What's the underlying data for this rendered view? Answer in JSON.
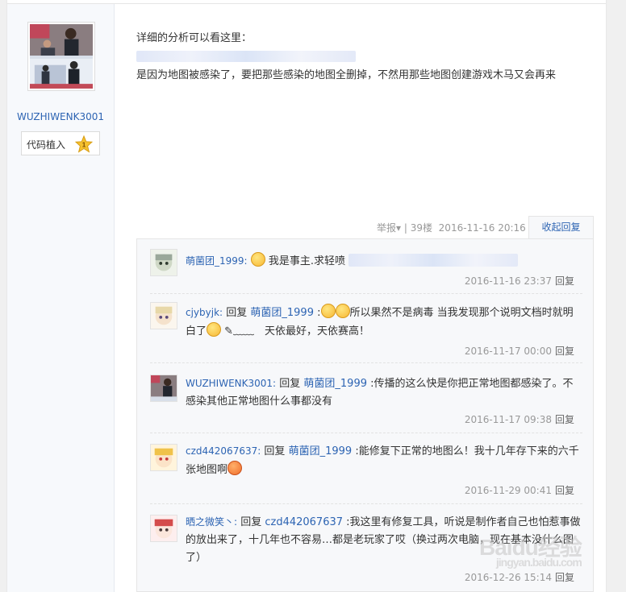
{
  "author": {
    "username": "WUZHIWENK3001",
    "badge_label": "代码植入",
    "badge_level": "1"
  },
  "post": {
    "line1": "详细的分析可以看这里：",
    "line3": "是因为地图被感染了，要把那些感染的地图全删掉，不然用那些地图创建游戏木马又会再来"
  },
  "meta": {
    "report": "举报",
    "arrow": "▾",
    "divider": "|",
    "floor": "39楼",
    "time": "2016-11-16 20:16",
    "collapse_label": "收起回复"
  },
  "replies": [
    {
      "name": "萌菌团_1999:",
      "text": "我是事主.求轻喷",
      "time": "2016-11-16 23:37",
      "reply_label": "回复"
    },
    {
      "name": "cjybyjk:",
      "prefix": "回复",
      "target": "萌菌团_1999",
      "sep": ":",
      "text1": "所以果然不是病毒 当我发现那个说明文档时就明白了",
      "text2": "✎﹏﹏　天依最好，天依赛高！",
      "time": "2016-11-17 00:00",
      "reply_label": "回复"
    },
    {
      "name": "WUZHIWENK3001:",
      "prefix": "回复",
      "target": "萌菌团_1999",
      "sep": ":",
      "text": "传播的这么快是你把正常地图都感染了。不感染其他正常地图什么事都没有",
      "time": "2016-11-17 09:38",
      "reply_label": "回复"
    },
    {
      "name": "czd442067637:",
      "prefix": "回复",
      "target": "萌菌团_1999",
      "sep": ":",
      "text": "能修复下正常的地图么！我十几年存下来的六千张地图啊",
      "time": "2016-11-29 00:41",
      "reply_label": "回复"
    },
    {
      "name": "晒之微笑丶:",
      "prefix": "回复",
      "target": "czd442067637",
      "sep": ":",
      "text": "我这里有修复工具，听说是制作者自己也怕惹事做的放出来了，十几年也不容易…都是老玩家了哎（换过两次电脑，现在基本没什么图了）",
      "time": "2016-12-26 15:14",
      "reply_label": "回复"
    }
  ],
  "watermark": {
    "text": "Baidu经验",
    "sub": "jingyan.baidu.com"
  },
  "colors": {
    "link": "#2d64b3",
    "meta": "#999999",
    "panel": "#f7f8fa"
  }
}
